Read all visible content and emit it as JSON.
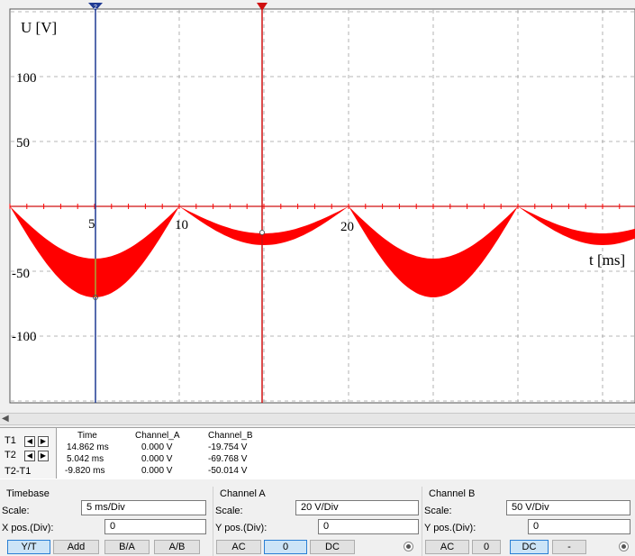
{
  "scope": {
    "y_axis_label": "U [V]",
    "x_axis_label": "t [ms]",
    "y_ticks": [
      "100",
      "50",
      "-50",
      "-100"
    ],
    "x_ticks": [
      "5",
      "10",
      "20"
    ],
    "cursor1_marker": "2",
    "colors": {
      "background": "#ffffff",
      "grid": "#a0a0a0",
      "trace": "#ff0000",
      "cursor1": "#1f3a93",
      "cursor2": "#d01010"
    }
  },
  "readout": {
    "columns": [
      "Time",
      "Channel_A",
      "Channel_B"
    ],
    "rows": [
      {
        "label": "T1",
        "time": "14.862 ms",
        "channel_a": "0.000 V",
        "channel_b": "-19.754 V"
      },
      {
        "label": "T2",
        "time": "5.042 ms",
        "channel_a": "0.000 V",
        "channel_b": "-69.768 V"
      },
      {
        "label": "T2-T1",
        "time": "-9.820 ms",
        "channel_a": "0.000 V",
        "channel_b": "-50.014 V"
      }
    ]
  },
  "timebase": {
    "title": "Timebase",
    "scale_label": "Scale:",
    "scale_value": "5 ms/Div",
    "xpos_label": "X pos.(Div):",
    "xpos_value": "0",
    "buttons": [
      "Y/T",
      "Add",
      "B/A",
      "A/B"
    ]
  },
  "channel_a": {
    "title": "Channel A",
    "scale_label": "Scale:",
    "scale_value": "20  V/Div",
    "ypos_label": "Y pos.(Div):",
    "ypos_value": "0",
    "buttons": [
      "AC",
      "0",
      "DC"
    ]
  },
  "channel_b": {
    "title": "Channel B",
    "scale_label": "Scale:",
    "scale_value": "50  V/Div",
    "ypos_label": "Y pos.(Div):",
    "ypos_value": "0",
    "buttons": [
      "AC",
      "0",
      "DC",
      "-"
    ]
  }
}
